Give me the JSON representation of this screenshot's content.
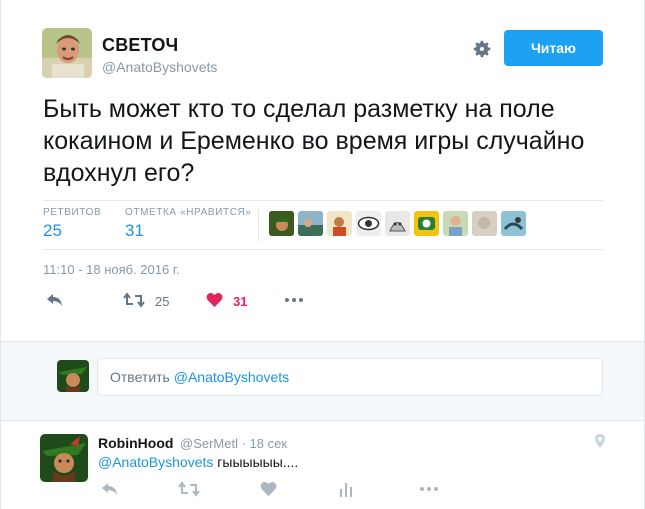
{
  "tweet": {
    "author_name": "СВЕТОЧ",
    "author_handle": "@AnatoByshovets",
    "follow_label": "Читаю",
    "text": "Быть может кто то сделал разметку на поле кокаином и Еременко во время игры случайно вдохнул его?",
    "stats": {
      "retweets_label": "РЕТВИТОВ",
      "retweets_value": "25",
      "likes_label": "ОТМЕТКА «НРАВИТСЯ»",
      "likes_value": "31"
    },
    "timestamp": "11:10 - 18 нояб. 2016 г.",
    "actions": {
      "retweet_count": "25",
      "like_count": "31"
    }
  },
  "reply_box": {
    "placeholder_prefix": "Ответить",
    "placeholder_mention": "@AnatoByshovets"
  },
  "reply": {
    "name": "RobinHood",
    "handle": "@SerMetl · 18 сек",
    "mention": "@AnatoByshovets",
    "text": "гыыыыыы...."
  },
  "colors": {
    "accent": "#1da1f2",
    "link": "#1b95e0",
    "like_red": "#e0245e",
    "muted": "#8899a6"
  },
  "icons": [
    "gear-icon",
    "reply-icon",
    "retweet-icon",
    "heart-icon",
    "more-icon",
    "analytics-icon",
    "location-pin-icon"
  ]
}
